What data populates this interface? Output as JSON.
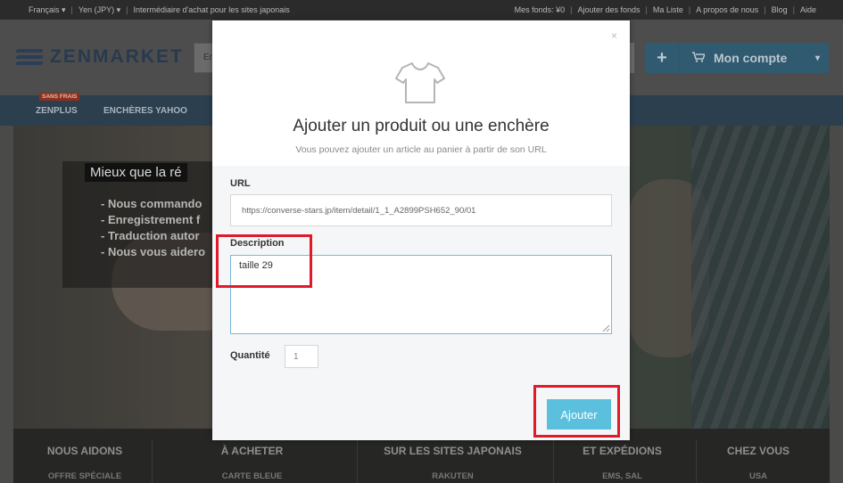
{
  "topbar": {
    "language": "Français",
    "currency": "Yen (JPY)",
    "tagline": "Intermédiaire d'achat pour les sites japonais",
    "funds": "Mes fonds: ¥0",
    "add_funds": "Ajouter des fonds",
    "wishlist": "Ma Liste",
    "about": "A propos de nous",
    "blog": "Blog",
    "help": "Aide"
  },
  "header": {
    "logo_text": "ZENMARKET",
    "search_stub": "En",
    "plus_label": "+",
    "account_label": "Mon compte"
  },
  "nav": {
    "badge": "SANS FRAIS",
    "items": [
      "ZENPLUS",
      "ENCHÈRES YAHOO"
    ]
  },
  "hero": {
    "title": "Mieux que la ré",
    "bullets": [
      "- Nous commando",
      "- Enregistrement f",
      "- Traduction autor",
      "- Nous vous aidero"
    ]
  },
  "footer": {
    "columns": [
      {
        "title": "NOUS AIDONS",
        "sub": "OFFRE SPÉCIALE"
      },
      {
        "title": "À ACHETER",
        "sub": "CARTE BLEUE"
      },
      {
        "title": "SUR LES SITES JAPONAIS",
        "sub": "RAKUTEN"
      },
      {
        "title": "ET EXPÉDIONS",
        "sub": "EMS, SAL"
      },
      {
        "title": "CHEZ VOUS",
        "sub": "USA"
      }
    ]
  },
  "modal": {
    "close": "×",
    "title": "Ajouter un produit ou une enchère",
    "subtitle": "Vous pouvez ajouter un article au panier à partir de son URL",
    "url_label": "URL",
    "url_value": "https://converse-stars.jp/item/detail/1_1_A2899PSH652_90/01",
    "description_label": "Description",
    "description_value": "taille 29",
    "quantity_label": "Quantité",
    "quantity_value": "1",
    "submit_label": "Ajouter"
  },
  "colors": {
    "accent": "#5bc0de",
    "highlight": "#e0192b",
    "brand_dark": "#283a4f"
  }
}
